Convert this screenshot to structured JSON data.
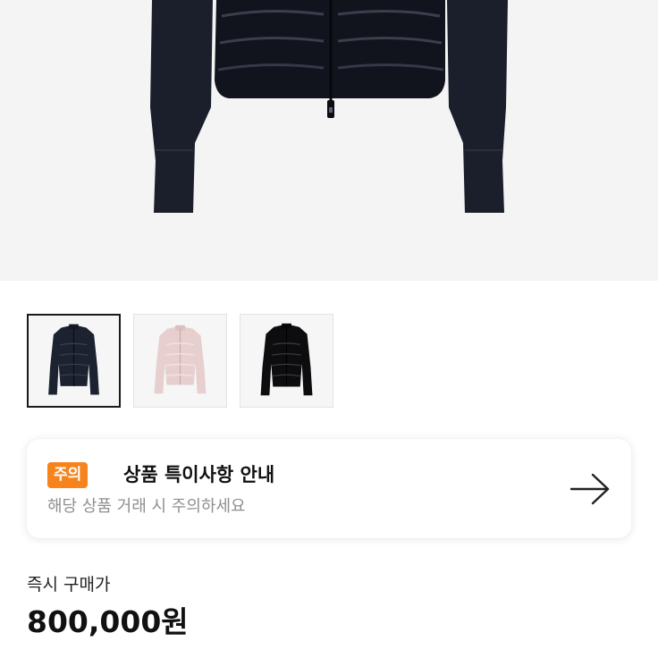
{
  "product_images": {
    "main": {
      "description_icon": "jacket-image"
    },
    "thumbnails": [
      {
        "icon": "navy-jacket-thumbnail",
        "selected": true
      },
      {
        "icon": "pink-jacket-thumbnail",
        "selected": false
      },
      {
        "icon": "black-jacket-thumbnail",
        "selected": false
      }
    ]
  },
  "notice": {
    "badge": "주의",
    "title": "상품 특이사항 안내",
    "subtitle": "해당 상품 거래 시 주의하세요",
    "arrow_icon": "arrow-right-icon",
    "badge_color": "#f7831d"
  },
  "price": {
    "label": "즉시 구매가",
    "value": "800,000원"
  }
}
